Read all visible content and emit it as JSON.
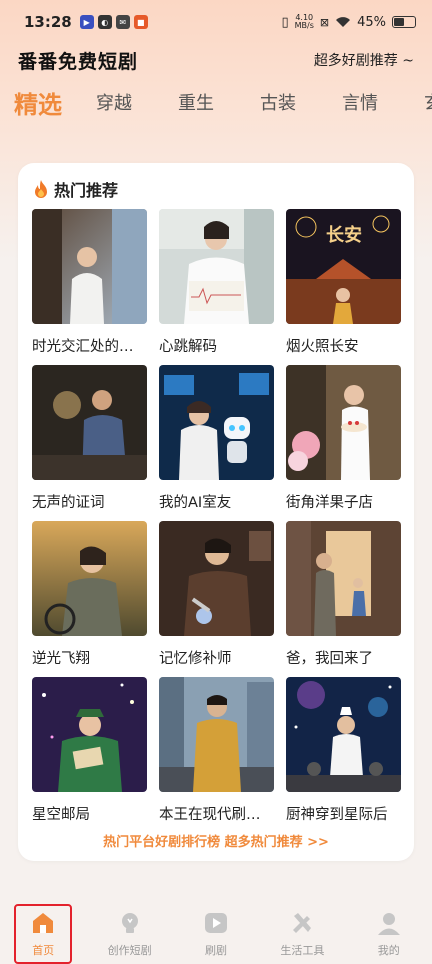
{
  "status_bar": {
    "time": "13:28",
    "net_speed_top": "4.10",
    "net_speed_bottom": "MB/s",
    "battery": "45%"
  },
  "header": {
    "title": "番番免费短剧",
    "promo": "超多好剧推荐 ~"
  },
  "tabs": [
    {
      "label": "精选",
      "active": true
    },
    {
      "label": "穿越",
      "active": false
    },
    {
      "label": "重生",
      "active": false
    },
    {
      "label": "古装",
      "active": false
    },
    {
      "label": "言情",
      "active": false
    },
    {
      "label": "玄",
      "active": false
    }
  ],
  "section": {
    "title": "热门推荐"
  },
  "dramas": [
    {
      "title": "时光交汇处的…"
    },
    {
      "title": "心跳解码"
    },
    {
      "title": "烟火照长安"
    },
    {
      "title": "无声的证词"
    },
    {
      "title": "我的AI室友"
    },
    {
      "title": "街角洋果子店"
    },
    {
      "title": "逆光飞翔"
    },
    {
      "title": "记忆修补师"
    },
    {
      "title": "爸，我回来了"
    },
    {
      "title": "星空邮局"
    },
    {
      "title": "本王在现代刷…"
    },
    {
      "title": "厨神穿到星际后"
    }
  ],
  "ranking_link": "热门平台好剧排行榜 超多热门推荐 >>",
  "bottom_nav": [
    {
      "label": "首页",
      "icon": "home-icon",
      "active": true
    },
    {
      "label": "创作短剧",
      "icon": "bulb-icon",
      "active": false
    },
    {
      "label": "刷剧",
      "icon": "play-icon",
      "active": false
    },
    {
      "label": "生活工具",
      "icon": "tools-icon",
      "active": false
    },
    {
      "label": "我的",
      "icon": "user-icon",
      "active": false
    }
  ],
  "colors": {
    "accent": "#f08a3c",
    "highlight": "#e3222c"
  }
}
